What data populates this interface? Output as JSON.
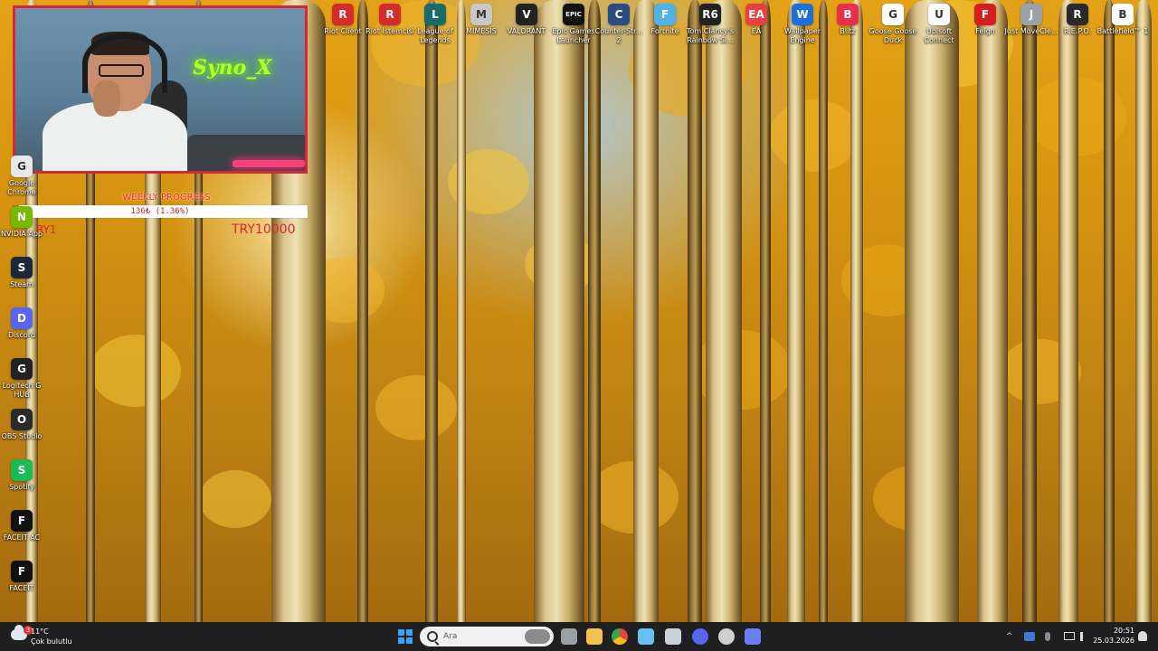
{
  "webcam": {
    "neon_sign": "Syno_X"
  },
  "goal": {
    "title": "WEEKLY PROGRESS",
    "progress_text": "136₺ (1.36%)",
    "progress_fraction": 0.0136,
    "target_label": "TRY10000",
    "left_label": "RY1"
  },
  "desktop_icons_top": [
    {
      "id": "riot-client",
      "label": "Riot Client",
      "glyph": "R",
      "color": "#d42b2b"
    },
    {
      "id": "riot-istemcisi",
      "label": "Riot İstemcisi",
      "glyph": "R",
      "color": "#d42b2b"
    },
    {
      "id": "league-of-legends",
      "label": "League of Legends",
      "glyph": "L",
      "color": "#1a6b6b"
    },
    {
      "id": "mimesis",
      "label": "MIMESIS",
      "glyph": "M",
      "color": "#c8c8c8"
    },
    {
      "id": "valorant",
      "label": "VALORANT",
      "glyph": "V",
      "color": "#222222"
    },
    {
      "id": "epic-games",
      "label": "Epic Games Launcher",
      "glyph": "EPIC",
      "color": "#111111"
    },
    {
      "id": "counter-strike",
      "label": "Counter-Str... 2",
      "glyph": "C",
      "color": "#2b4d80"
    },
    {
      "id": "fortnite",
      "label": "Fortnite",
      "glyph": "F",
      "color": "#4fb3e6"
    },
    {
      "id": "rainbow-six",
      "label": "Tom Clancy's Rainbow Si...",
      "glyph": "R6",
      "color": "#222222"
    },
    {
      "id": "ea",
      "label": "EA",
      "glyph": "EA",
      "color": "#e84040"
    },
    {
      "id": "wallpaper-engine",
      "label": "Wallpaper Engine",
      "glyph": "W",
      "color": "#1e6fd9"
    },
    {
      "id": "blitz",
      "label": "Blitz",
      "glyph": "B",
      "color": "#e8304a"
    },
    {
      "id": "goose-goose-duck",
      "label": "Goose Goose Duck",
      "glyph": "G",
      "color": "#ffffff"
    },
    {
      "id": "ubisoft-connect",
      "label": "Ubisoft Connect",
      "glyph": "U",
      "color": "#ffffff"
    },
    {
      "id": "feign",
      "label": "Feign",
      "glyph": "F",
      "color": "#d61e1e"
    },
    {
      "id": "just-move-clean",
      "label": "Just MoveCle...",
      "glyph": "J",
      "color": "#9aa2a8"
    },
    {
      "id": "repo",
      "label": "R.E.P.O.",
      "glyph": "R",
      "color": "#2a2a2a"
    },
    {
      "id": "battlefield",
      "label": "Battlefield™ 1",
      "glyph": "B",
      "color": "#ffffff"
    }
  ],
  "desktop_icons_left": [
    {
      "id": "google-chrome",
      "label": "Google Chrome",
      "glyph": "G",
      "color": "#e8e8e8"
    },
    {
      "id": "nvidia-app",
      "label": "NVIDIA App",
      "glyph": "N",
      "color": "#76b900"
    },
    {
      "id": "steam",
      "label": "Steam",
      "glyph": "S",
      "color": "#1b2838"
    },
    {
      "id": "discord",
      "label": "Discord",
      "glyph": "D",
      "color": "#5865f2"
    },
    {
      "id": "logitech-g-hub",
      "label": "Logitech G HUB",
      "glyph": "G",
      "color": "#222222"
    },
    {
      "id": "obs-studio",
      "label": "OBS Studio",
      "glyph": "O",
      "color": "#2a2a2a"
    },
    {
      "id": "spotify",
      "label": "Spotify",
      "glyph": "S",
      "color": "#1db954"
    },
    {
      "id": "faceit-ac",
      "label": "FACEIT AC",
      "glyph": "F",
      "color": "#111111"
    },
    {
      "id": "faceit",
      "label": "FACEIT",
      "glyph": "F",
      "color": "#111111"
    }
  ],
  "taskbar": {
    "weather_temp": "11°C",
    "weather_condition": "Çok bulutlu",
    "weather_badge": "3",
    "search_placeholder": "Ara",
    "time": "20:51",
    "date": "25.03.2026",
    "apps": [
      {
        "id": "task-view",
        "color": "#9aa0a6"
      },
      {
        "id": "file-explorer",
        "color": "#f2c14e"
      },
      {
        "id": "chrome",
        "color": "#e8453c"
      },
      {
        "id": "steam",
        "color": "#66c0f4"
      },
      {
        "id": "riot-client",
        "color": "#c9d1d9"
      },
      {
        "id": "discord",
        "color": "#5865f2"
      },
      {
        "id": "obs-studio",
        "color": "#cfcfcf"
      },
      {
        "id": "wallpaper-engine",
        "color": "#6b7cff"
      }
    ]
  }
}
